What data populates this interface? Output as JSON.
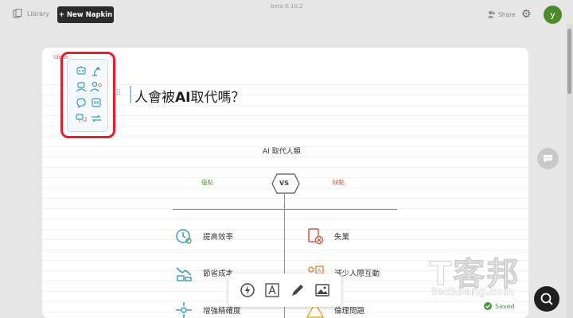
{
  "topbar": {
    "library_label": "Library",
    "new_button_label": "+ New Napkin",
    "version": "beta-0.10.2",
    "share_label": "Share",
    "avatar_initial": "y"
  },
  "panel": {
    "back_label": "Ideas",
    "icons": [
      "robot-face-icon",
      "robot-arm-icon",
      "robot-bust-icon",
      "person-gear-icon",
      "brain-chat-icon",
      "circuit-head-icon",
      "speech-bubble-icon",
      "exchange-icon"
    ]
  },
  "document": {
    "title_prefix": "人會被",
    "title_bold": "AI",
    "title_suffix": "取代嗎？"
  },
  "diagram": {
    "heading": "AI 取代人類",
    "vs": "VS",
    "pro_label": "優點",
    "con_label": "缺點",
    "pros": [
      {
        "label": "提高效率",
        "icon": "clock-gear-icon"
      },
      {
        "label": "節省成本",
        "icon": "money-chart-icon"
      },
      {
        "label": "增強精確度",
        "icon": "target-crosshair-icon"
      }
    ],
    "cons": [
      {
        "label": "失業",
        "icon": "document-reject-icon"
      },
      {
        "label": "減少人際互動",
        "icon": "ai-person-icon"
      },
      {
        "label": "倫理問題",
        "icon": "warning-icon"
      }
    ]
  },
  "toolbar": {
    "tools": [
      "ai-spark-icon",
      "text-box-icon",
      "pen-icon",
      "image-icon"
    ]
  },
  "status": {
    "saved_label": "Saved"
  },
  "watermark": {
    "cn": "T客邦",
    "en": "techbang.com"
  },
  "colors": {
    "highlight": "#e0202a",
    "pro": "#5a9a3a",
    "con": "#d0584a",
    "avatar": "#4d8a2c",
    "icon_teal": "#3b9ab8"
  }
}
